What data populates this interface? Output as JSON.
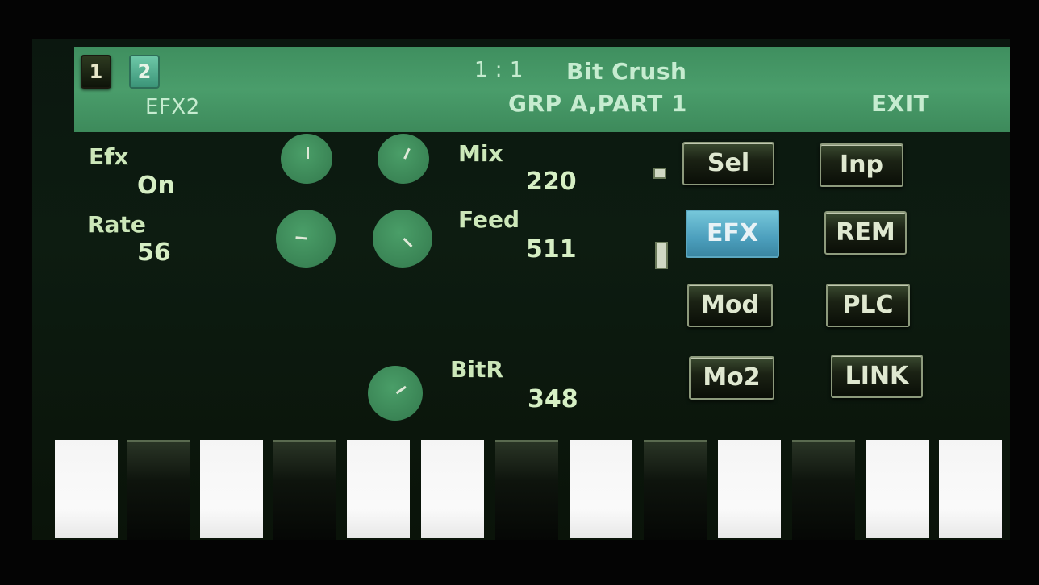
{
  "header": {
    "channel_buttons": [
      "1",
      "2"
    ],
    "page_label": "EFX2",
    "position": "1 : 1",
    "effect_name": "Bit Crush",
    "group_part": "GRP A,PART 1",
    "exit_label": "EXIT"
  },
  "params": {
    "efx": {
      "label": "Efx",
      "value": "On"
    },
    "rate": {
      "label": "Rate",
      "value": "56"
    },
    "mix": {
      "label": "Mix",
      "value": "220"
    },
    "feed": {
      "label": "Feed",
      "value": "511"
    },
    "bitr": {
      "label": "BitR",
      "value": "348"
    }
  },
  "buttons": {
    "sel": "Sel",
    "inp": "Inp",
    "efx": "EFX",
    "rem": "REM",
    "mod": "Mod",
    "plc": "PLC",
    "mo2": "Mo2",
    "link": "LINK",
    "active": "EFX"
  },
  "keyboard": {
    "keys": [
      "white",
      "dark",
      "white",
      "dark",
      "white",
      "white",
      "dark",
      "white",
      "dark",
      "white",
      "dark",
      "white",
      "white"
    ]
  },
  "colors": {
    "header_bg": "#4a9d6b",
    "active_button": "#4c9fbd",
    "knob": "#3a8455"
  }
}
